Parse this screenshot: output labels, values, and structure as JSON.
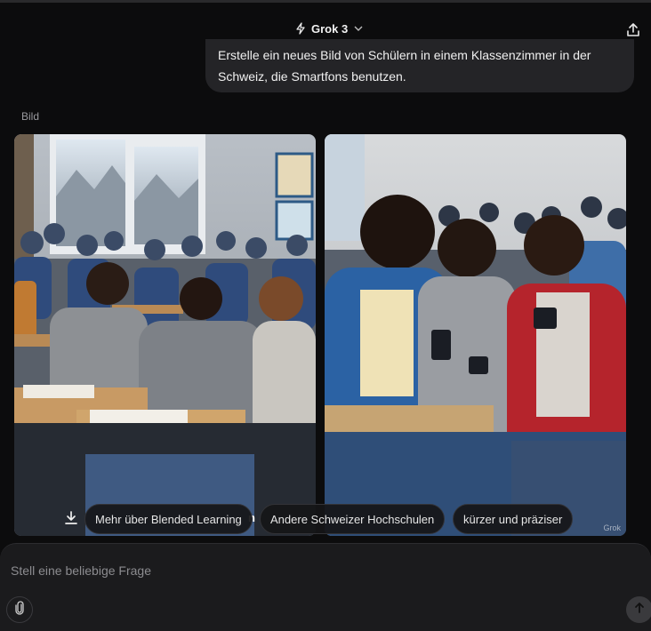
{
  "header": {
    "model_label": "Grok 3",
    "model_icon": "lightning-icon",
    "dropdown_icon": "chevron-down-icon",
    "share_icon": "share-icon"
  },
  "conversation": {
    "user_message": "Erstelle ein neues Bild von Schülern in einem Klassenzimmer in der Schweiz, die Smartfons benutzen."
  },
  "images": {
    "label": "Bild",
    "watermark": "Grok",
    "download_icon": "download-icon"
  },
  "suggestions": {
    "partial_fragment": "n",
    "items": [
      "Mehr über Blended Learning",
      "Andere Schweizer Hochschulen",
      "kürzer und präziser"
    ]
  },
  "composer": {
    "placeholder": "Stell eine beliebige Frage",
    "attach_icon": "paperclip-icon",
    "send_icon": "arrow-up-icon"
  },
  "colors": {
    "background": "#0c0c0d",
    "bubble": "#242427",
    "composer": "#1b1b1d",
    "chip": "#161618"
  }
}
